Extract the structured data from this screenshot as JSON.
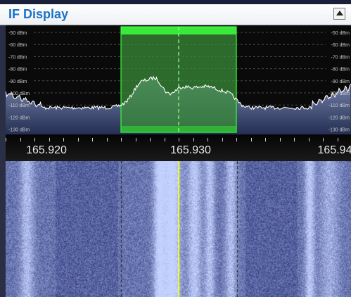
{
  "panel": {
    "title": "IF Display",
    "collapse_icon": "triangle-up-icon"
  },
  "spectrum": {
    "level_labels": [
      "-50 dBm",
      "-60 dBm",
      "-70 dBm",
      "-80 dBm",
      "-90 dBm",
      "-100 dBm",
      "-110 dBm",
      "-120 dBm",
      "-130 dBm"
    ],
    "colors": {
      "background": "#0a0a0a",
      "trace": "#ffffff",
      "fill_top": "#8a98c8",
      "fill_bottom": "#27325a",
      "filter_window": "#3a8c3a",
      "filter_edge": "#3dff3d",
      "center_line": "#9cff9c"
    }
  },
  "frequency_axis": {
    "labels": [
      "165.920",
      "165.930",
      "165.94"
    ]
  },
  "waterfall": {
    "colors": {
      "low": "#2a3578",
      "high": "#c4d2ff",
      "tuned_line": "#f0ff2a"
    }
  }
}
